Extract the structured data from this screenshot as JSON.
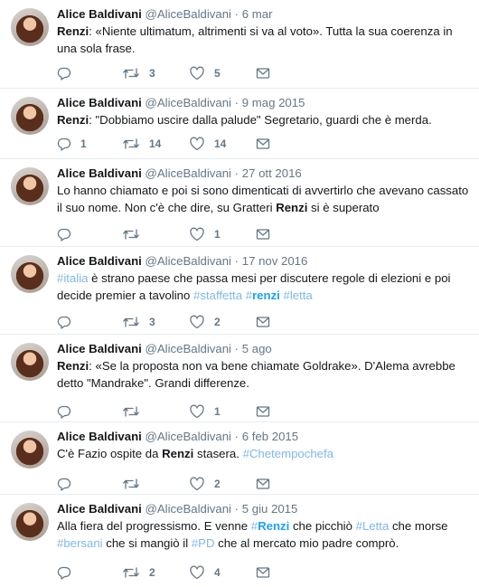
{
  "tweets": [
    {
      "name": "Alice Baldivani",
      "handle": "@AliceBaldivani",
      "date": "6 mar",
      "segments": [
        {
          "t": "Renzi",
          "b": true
        },
        {
          "t": ": «Niente ultimatum, altrimenti si va al voto». Tutta la sua coerenza in una sola frase."
        }
      ],
      "replies": "",
      "retweets": "3",
      "likes": "5"
    },
    {
      "name": "Alice Baldivani",
      "handle": "@AliceBaldivani",
      "date": "9 mag 2015",
      "segments": [
        {
          "t": "Renzi",
          "b": true
        },
        {
          "t": ": \"Dobbiamo uscire dalla palude\"  Segretario, guardi che è merda."
        }
      ],
      "replies": "1",
      "retweets": "14",
      "likes": "14"
    },
    {
      "name": "Alice Baldivani",
      "handle": "@AliceBaldivani",
      "date": "27 ott 2016",
      "segments": [
        {
          "t": "Lo hanno chiamato e poi si sono dimenticati di avvertirlo che avevano cassato il suo nome. Non c'è che dire, su Gratteri "
        },
        {
          "t": "Renzi",
          "b": true
        },
        {
          "t": " si è superato"
        }
      ],
      "replies": "",
      "retweets": "",
      "likes": "1"
    },
    {
      "name": "Alice Baldivani",
      "handle": "@AliceBaldivani",
      "date": "17 nov 2016",
      "segments": [
        {
          "t": "#italia",
          "tag": true
        },
        {
          "t": " è strano paese che passa mesi per discutere regole di elezioni e poi decide premier a tavolino  "
        },
        {
          "t": "#staffetta",
          "tag": true
        },
        {
          "t": " "
        },
        {
          "t": "#",
          "tag": true
        },
        {
          "t": "renzi",
          "tag": true,
          "b": true
        },
        {
          "t": " "
        },
        {
          "t": "#letta",
          "tag": true
        }
      ],
      "replies": "",
      "retweets": "3",
      "likes": "2"
    },
    {
      "name": "Alice Baldivani",
      "handle": "@AliceBaldivani",
      "date": "5 ago",
      "segments": [
        {
          "t": "Renzi",
          "b": true
        },
        {
          "t": ": «Se la proposta non va bene chiamate Goldrake». D'Alema avrebbe detto \"Mandrake\". Grandi differenze."
        }
      ],
      "replies": "",
      "retweets": "",
      "likes": "1"
    },
    {
      "name": "Alice Baldivani",
      "handle": "@AliceBaldivani",
      "date": "6 feb 2015",
      "segments": [
        {
          "t": "C'è Fazio ospite da "
        },
        {
          "t": "Renzi",
          "b": true
        },
        {
          "t": " stasera.  "
        },
        {
          "t": "#Chetempochefa",
          "tag": true
        }
      ],
      "replies": "",
      "retweets": "",
      "likes": "2"
    },
    {
      "name": "Alice Baldivani",
      "handle": "@AliceBaldivani",
      "date": "5 giu 2015",
      "segments": [
        {
          "t": "Alla fiera del progressismo.  E venne "
        },
        {
          "t": "#",
          "tag": true
        },
        {
          "t": "Renzi",
          "tag": true,
          "b": true
        },
        {
          "t": "  che picchiò "
        },
        {
          "t": "#Letta",
          "tag": true
        },
        {
          "t": " che morse "
        },
        {
          "t": "#bersani",
          "tag": true
        },
        {
          "t": "  che si mangiò il "
        },
        {
          "t": "#PD",
          "tag": true
        },
        {
          "t": "  che al mercato mio padre comprò."
        }
      ],
      "replies": "",
      "retweets": "2",
      "likes": "4"
    }
  ]
}
